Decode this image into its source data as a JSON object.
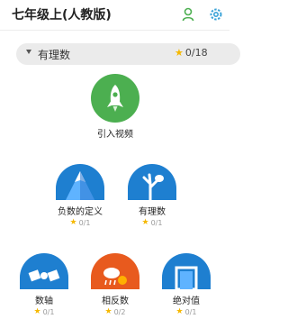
{
  "header": {
    "title": "七年级上(人教版)"
  },
  "icons": {
    "user": "user-icon",
    "settings": "gear-icon"
  },
  "colors": {
    "accent": "#3aa3d8",
    "green": "#4caf50",
    "star": "#f5b800",
    "blue": "#1e7fd0",
    "orange": "#e85a1e"
  },
  "section": {
    "name": "有理数",
    "progress": "0/18"
  },
  "lessons": [
    {
      "label": "引入视频",
      "progress": ""
    },
    {
      "label": "负数的定义",
      "progress": "0/1"
    },
    {
      "label": "有理数",
      "progress": "0/1"
    },
    {
      "label": "数轴",
      "progress": "0/1"
    },
    {
      "label": "相反数",
      "progress": "0/2"
    },
    {
      "label": "绝对值",
      "progress": "0/1"
    }
  ]
}
